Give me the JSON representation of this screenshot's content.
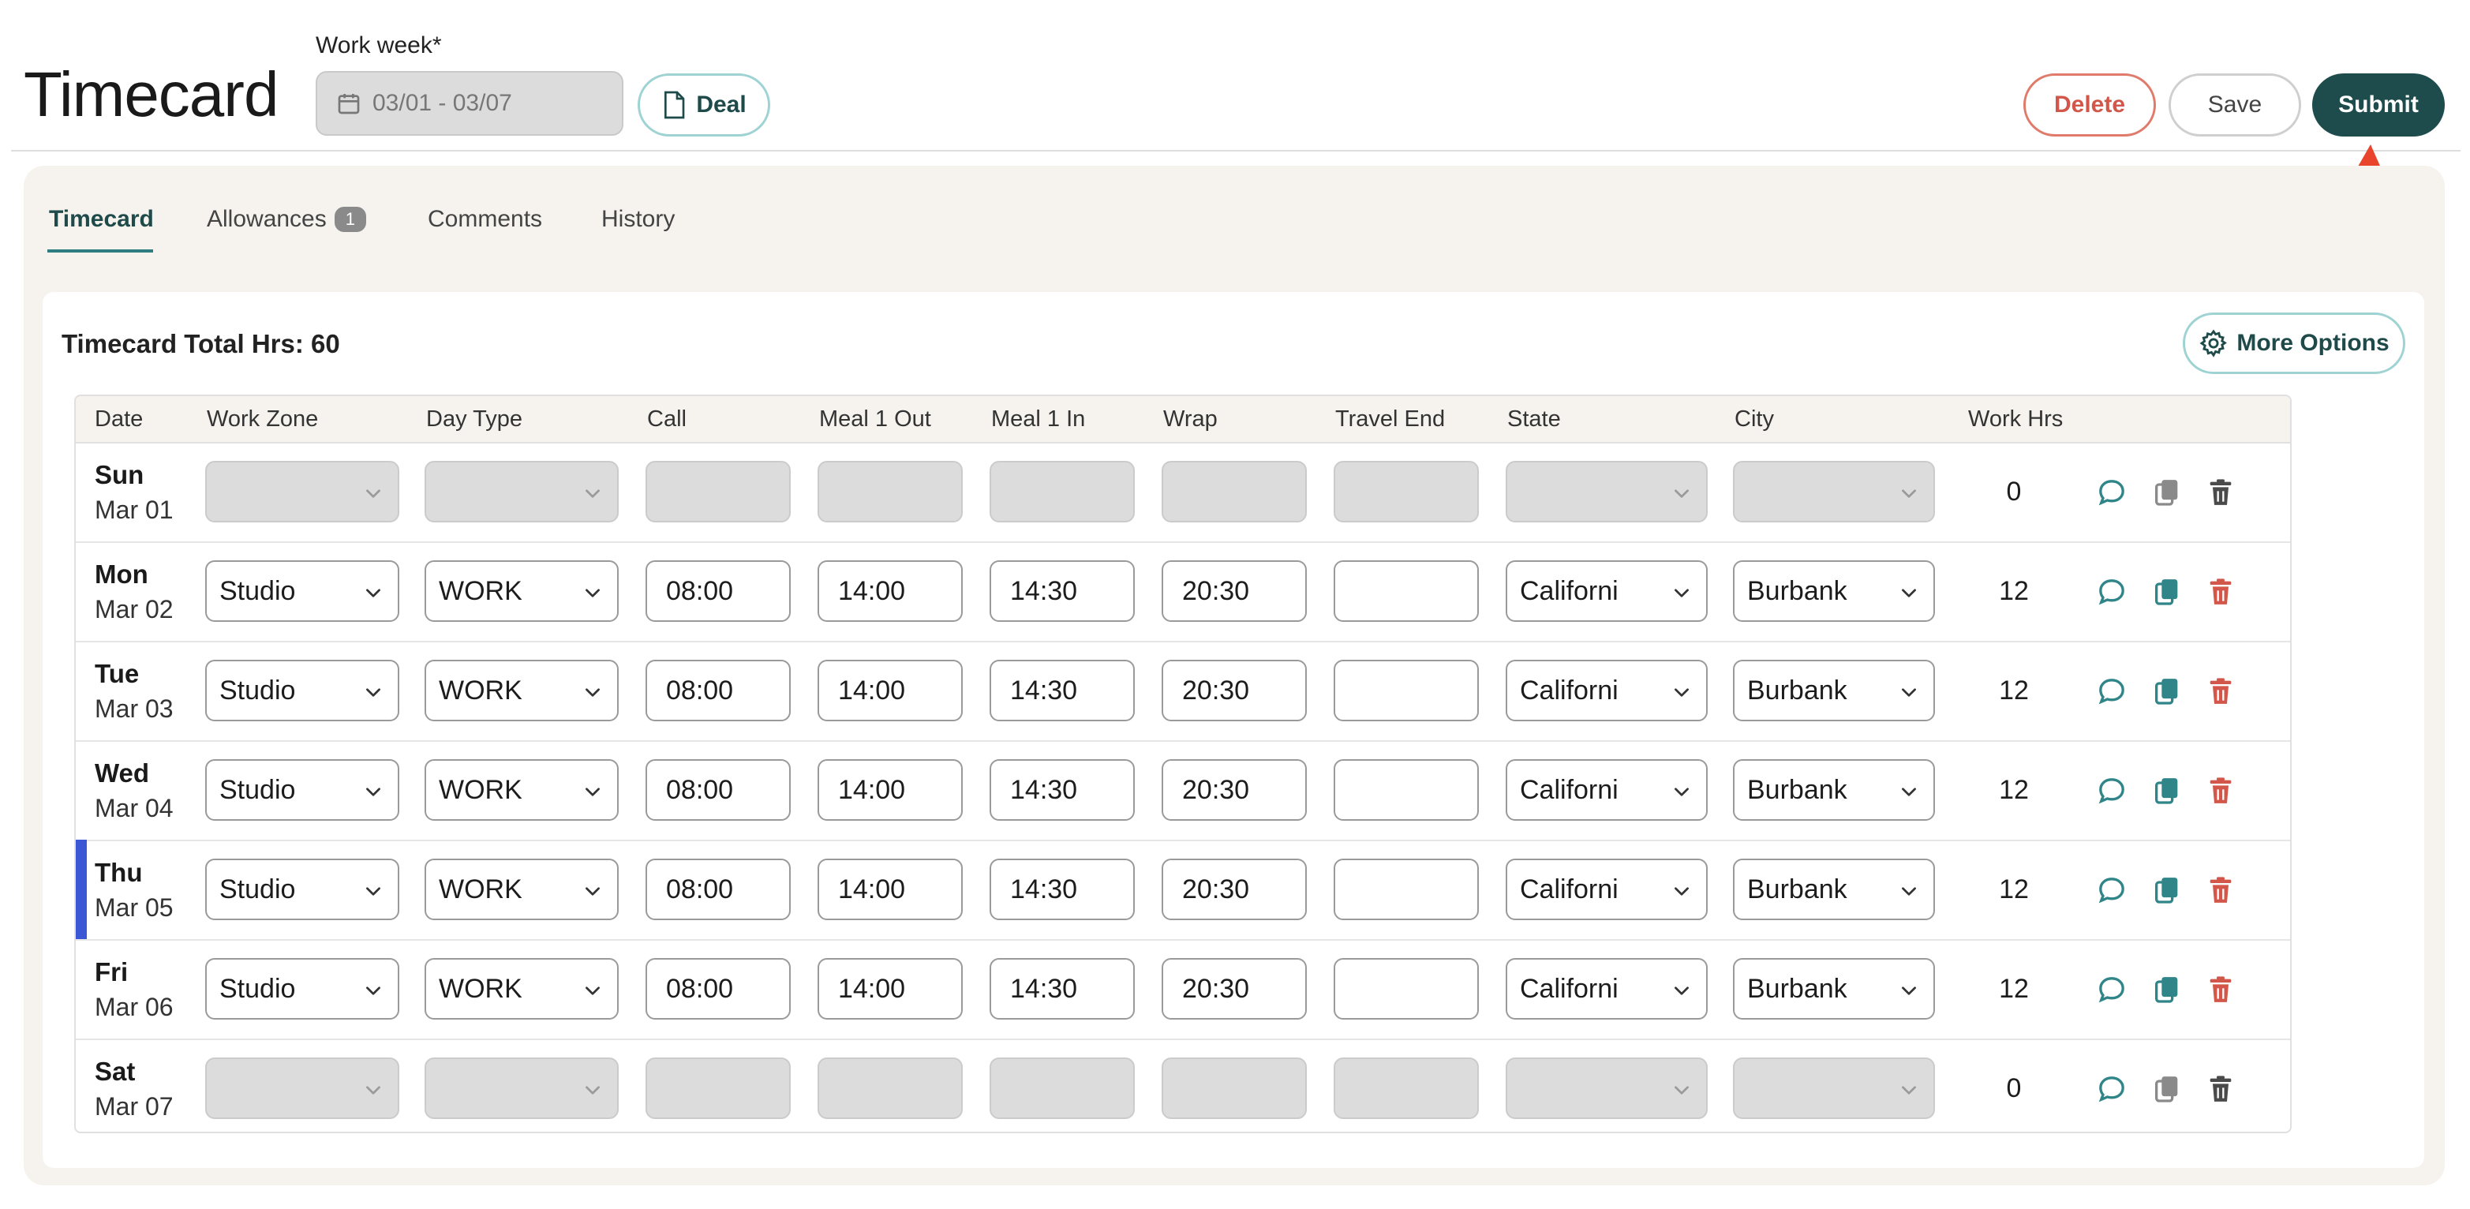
{
  "header": {
    "title": "Timecard",
    "work_week_label": "Work week*",
    "work_week_value": "03/01 - 03/07",
    "deal_label": "Deal",
    "delete_label": "Delete",
    "save_label": "Save",
    "submit_label": "Submit"
  },
  "tabs": [
    {
      "label": "Timecard",
      "active": true
    },
    {
      "label": "Allowances",
      "badge": "1"
    },
    {
      "label": "Comments"
    },
    {
      "label": "History"
    }
  ],
  "summary": {
    "total_hrs_label": "Timecard Total Hrs: 60",
    "more_options_label": "More Options"
  },
  "columns": [
    "Date",
    "Work Zone",
    "Day Type",
    "Call",
    "Meal 1 Out",
    "Meal 1 In",
    "Wrap",
    "Travel End",
    "State",
    "City",
    "Work Hrs"
  ],
  "rows": [
    {
      "day": "Sun",
      "date": "Mar 01",
      "work_zone": "",
      "day_type": "",
      "call": "",
      "meal1_out": "",
      "meal1_in": "",
      "wrap": "",
      "travel_end": "",
      "state": "",
      "city": "",
      "work_hrs": "0",
      "disabled": true
    },
    {
      "day": "Mon",
      "date": "Mar 02",
      "work_zone": "Studio",
      "day_type": "WORK",
      "call": "08:00",
      "meal1_out": "14:00",
      "meal1_in": "14:30",
      "wrap": "20:30",
      "travel_end": "",
      "state": "Californi",
      "city": "Burbank",
      "work_hrs": "12"
    },
    {
      "day": "Tue",
      "date": "Mar 03",
      "work_zone": "Studio",
      "day_type": "WORK",
      "call": "08:00",
      "meal1_out": "14:00",
      "meal1_in": "14:30",
      "wrap": "20:30",
      "travel_end": "",
      "state": "Californi",
      "city": "Burbank",
      "work_hrs": "12"
    },
    {
      "day": "Wed",
      "date": "Mar 04",
      "work_zone": "Studio",
      "day_type": "WORK",
      "call": "08:00",
      "meal1_out": "14:00",
      "meal1_in": "14:30",
      "wrap": "20:30",
      "travel_end": "",
      "state": "Californi",
      "city": "Burbank",
      "work_hrs": "12"
    },
    {
      "day": "Thu",
      "date": "Mar 05",
      "work_zone": "Studio",
      "day_type": "WORK",
      "call": "08:00",
      "meal1_out": "14:00",
      "meal1_in": "14:30",
      "wrap": "20:30",
      "travel_end": "",
      "state": "Californi",
      "city": "Burbank",
      "work_hrs": "12",
      "highlight": true
    },
    {
      "day": "Fri",
      "date": "Mar 06",
      "work_zone": "Studio",
      "day_type": "WORK",
      "call": "08:00",
      "meal1_out": "14:00",
      "meal1_in": "14:30",
      "wrap": "20:30",
      "travel_end": "",
      "state": "Californi",
      "city": "Burbank",
      "work_hrs": "12"
    },
    {
      "day": "Sat",
      "date": "Mar 07",
      "work_zone": "",
      "day_type": "",
      "call": "",
      "meal1_out": "",
      "meal1_in": "",
      "wrap": "",
      "travel_end": "",
      "state": "",
      "city": "",
      "work_hrs": "0",
      "disabled": true
    }
  ],
  "icons": {
    "calendar": "calendar-icon",
    "document": "document-icon",
    "gear": "gear-icon",
    "comment": "comment-icon",
    "copy": "copy-icon",
    "trash": "trash-icon",
    "chevron": "chevron-down-icon"
  },
  "colors": {
    "primary": "#1e4c4c",
    "teal_accent": "#2f8588",
    "danger": "#d2574a",
    "highlight_bar": "#3b57d6",
    "panel_bg": "#f6f3ee",
    "annotation_arrow": "#e8452c"
  }
}
